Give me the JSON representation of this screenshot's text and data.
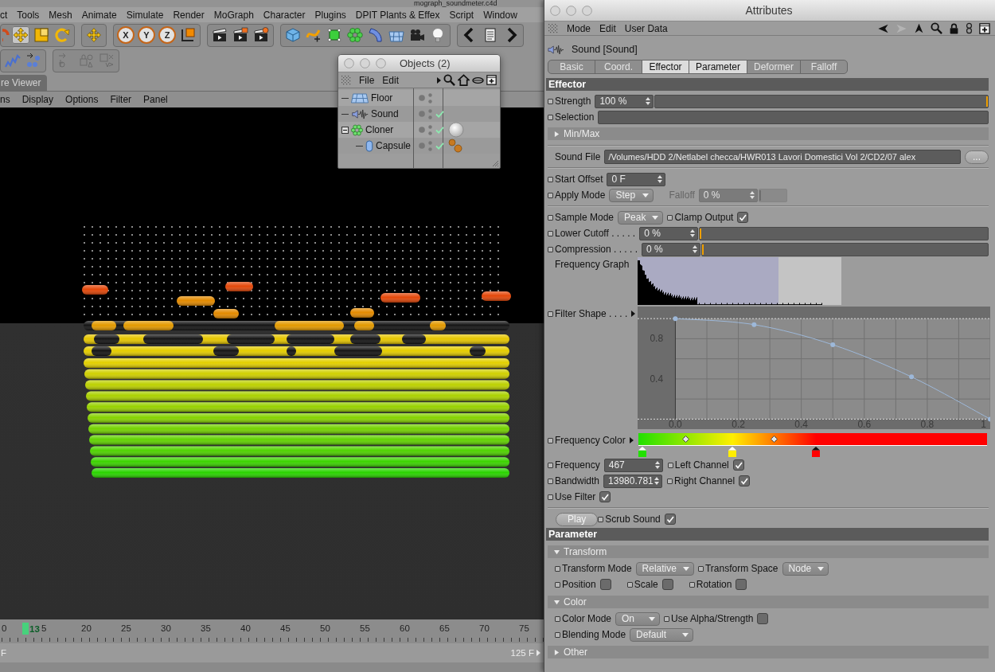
{
  "document_title": "mograph_soundmeter.c4d",
  "menu_bar": [
    "ct",
    "Tools",
    "Mesh",
    "Animate",
    "Simulate",
    "Render",
    "MoGraph",
    "Character",
    "Plugins",
    "DPIT Plants & Effex",
    "Script",
    "Window"
  ],
  "toolbar": {
    "tools": [
      {
        "kind": "move",
        "selected": true
      },
      {
        "kind": "scale",
        "selected": false
      },
      {
        "kind": "rotate",
        "selected": false
      }
    ],
    "axes": [
      "X",
      "Y",
      "Z"
    ]
  },
  "viewer": {
    "tab": "re Viewer",
    "menu": [
      "ns",
      "Display",
      "Options",
      "Filter",
      "Panel"
    ]
  },
  "timeline": {
    "labels": [
      "0",
      "5",
      "20",
      "25",
      "30",
      "35",
      "40",
      "45",
      "50",
      "55",
      "60",
      "65",
      "70",
      "75"
    ],
    "current_frame": "13",
    "start": "F",
    "end": "125 F"
  },
  "objects_window": {
    "title": "Objects (2)",
    "menu": [
      "File",
      "Edit"
    ],
    "tree": [
      {
        "name": "Floor",
        "kind": "floor",
        "enabled": false
      },
      {
        "name": "Sound",
        "kind": "sound",
        "enabled": true
      },
      {
        "name": "Cloner",
        "kind": "cloner",
        "enabled": true,
        "tags": [
          {
            "kind": "display"
          }
        ],
        "expanded": true,
        "children": [
          {
            "name": "Capsule",
            "kind": "capsule",
            "enabled": true,
            "tags": [
              {
                "kind": "material"
              }
            ]
          }
        ]
      }
    ]
  },
  "attributes": {
    "title": "Attributes",
    "menu": [
      "Mode",
      "Edit",
      "User Data"
    ],
    "object": "Sound [Sound]",
    "tabs": [
      {
        "label": "Basic",
        "selected": false
      },
      {
        "label": "Coord.",
        "selected": false
      },
      {
        "label": "Effector",
        "selected": true
      },
      {
        "label": "Parameter",
        "selected": true
      },
      {
        "label": "Deformer",
        "selected": false
      },
      {
        "label": "Falloff",
        "selected": false
      }
    ],
    "items": [
      {
        "kind": "header",
        "title": "Effector"
      },
      {
        "kind": "row",
        "controls": [
          {
            "kind": "slider",
            "label": "Strength",
            "value": "100 %",
            "level": 1
          }
        ]
      },
      {
        "kind": "row",
        "controls": [
          {
            "kind": "link",
            "label": "Selection"
          }
        ]
      },
      {
        "kind": "group",
        "title": "Min/Max",
        "expanded": false
      },
      {
        "kind": "divider"
      },
      {
        "kind": "row",
        "controls": [
          {
            "kind": "file",
            "label": "Sound File",
            "value": "/Volumes/HDD 2/Netlabel checca/HWR013 Lavori Domestici Vol 2/CD2/07 alex",
            "button": "..."
          }
        ]
      },
      {
        "kind": "divider"
      },
      {
        "kind": "row",
        "controls": [
          {
            "kind": "number",
            "label": "Start Offset",
            "value": "0 F"
          }
        ]
      },
      {
        "kind": "row",
        "controls": [
          {
            "kind": "dropdown",
            "label": "Apply Mode",
            "value": "Step"
          },
          {
            "kind": "slider",
            "label": "Falloff",
            "value": "0 %",
            "level": 0,
            "disabled": true
          }
        ]
      },
      {
        "kind": "divider"
      },
      {
        "kind": "row",
        "controls": [
          {
            "kind": "dropdown",
            "label": "Sample Mode",
            "value": "Peak"
          },
          {
            "kind": "checkbox",
            "label": "Clamp Output",
            "checked": true
          }
        ]
      },
      {
        "kind": "row",
        "controls": [
          {
            "kind": "slider",
            "label": "Lower Cutoff . . . . .",
            "value": "0 %",
            "level": 0
          }
        ]
      },
      {
        "kind": "row",
        "controls": [
          {
            "kind": "slider",
            "label": "Compression . . . . .",
            "value": "0 %",
            "level": 0
          }
        ]
      },
      {
        "kind": "spectrum",
        "label": "Frequency Graph"
      },
      {
        "kind": "curve",
        "label": "Filter Shape . . . .",
        "chart_data": {
          "type": "line",
          "x": [
            0,
            0.25,
            0.5,
            0.75,
            1
          ],
          "series": [
            {
              "color": "#9db8d9",
              "values": [
                1,
                0.94,
                0.74,
                0.42,
                0
              ],
              "marker": "o"
            }
          ],
          "xlim": [
            -0.12,
            1
          ],
          "ylim": [
            -0.1,
            1.12
          ],
          "xticks": [
            {
              "value": 0,
              "label": "0.0"
            },
            0.2,
            0.4,
            0.6,
            0.8,
            1
          ],
          "yticks": [
            0.8,
            0.4
          ],
          "grid": true,
          "ref_lines": [
            {
              "axis": "y",
              "value": 1
            },
            {
              "axis": "y",
              "value": 0
            }
          ],
          "bands": [
            {
              "axis": "y",
              "from": 1,
              "to": 1.12
            },
            {
              "axis": "y",
              "from": -0.1,
              "to": 0
            },
            {
              "axis": "x",
              "from": -0.12,
              "to": 0
            }
          ]
        }
      },
      {
        "kind": "gradient",
        "label": "Frequency Color",
        "knots": [
          {
            "color": "#22e000",
            "level": 0,
            "selected": false
          },
          {
            "color": "#ffee00",
            "level": 0.27,
            "selected": false
          },
          {
            "color": "#ff0000",
            "level": 0.51,
            "selected": true
          }
        ]
      },
      {
        "kind": "row",
        "controls": [
          {
            "kind": "number",
            "label": "Frequency",
            "value": "467"
          },
          {
            "kind": "checkbox",
            "label": "Left Channel",
            "checked": true
          }
        ]
      },
      {
        "kind": "row",
        "controls": [
          {
            "kind": "number",
            "label": "Bandwidth",
            "value": "13980.781"
          },
          {
            "kind": "checkbox",
            "label": "Right Channel",
            "checked": true
          }
        ]
      },
      {
        "kind": "row",
        "controls": [
          {
            "kind": "checkbox",
            "label": "Use Filter",
            "checked": true
          }
        ]
      },
      {
        "kind": "divider"
      },
      {
        "kind": "row",
        "controls": [
          {
            "kind": "button",
            "label": "Play"
          },
          {
            "kind": "checkbox",
            "label": "Scrub Sound",
            "checked": true
          }
        ]
      },
      {
        "kind": "header",
        "title": "Parameter"
      },
      {
        "kind": "group",
        "title": "Transform",
        "expanded": true,
        "children": [
          {
            "kind": "row",
            "controls": [
              {
                "kind": "dropdown",
                "label": "Transform Mode",
                "value": "Relative"
              },
              {
                "kind": "dropdown",
                "label": "Transform Space",
                "value": "Node"
              }
            ]
          },
          {
            "kind": "row",
            "controls": [
              {
                "kind": "checkbox",
                "label": "Position",
                "checked": false
              },
              {
                "kind": "checkbox",
                "label": "Scale",
                "checked": false
              },
              {
                "kind": "checkbox",
                "label": "Rotation",
                "checked": false
              }
            ]
          }
        ]
      },
      {
        "kind": "group",
        "title": "Color",
        "expanded": true,
        "children": [
          {
            "kind": "row",
            "controls": [
              {
                "kind": "dropdown",
                "label": "Color Mode",
                "value": "On"
              },
              {
                "kind": "checkbox",
                "label": "Use Alpha/Strength",
                "checked": false
              }
            ]
          },
          {
            "kind": "row",
            "controls": [
              {
                "kind": "dropdown",
                "label": "Blending Mode",
                "value": "Default"
              }
            ]
          }
        ]
      },
      {
        "kind": "group",
        "title": "Other",
        "expanded": false
      }
    ]
  }
}
